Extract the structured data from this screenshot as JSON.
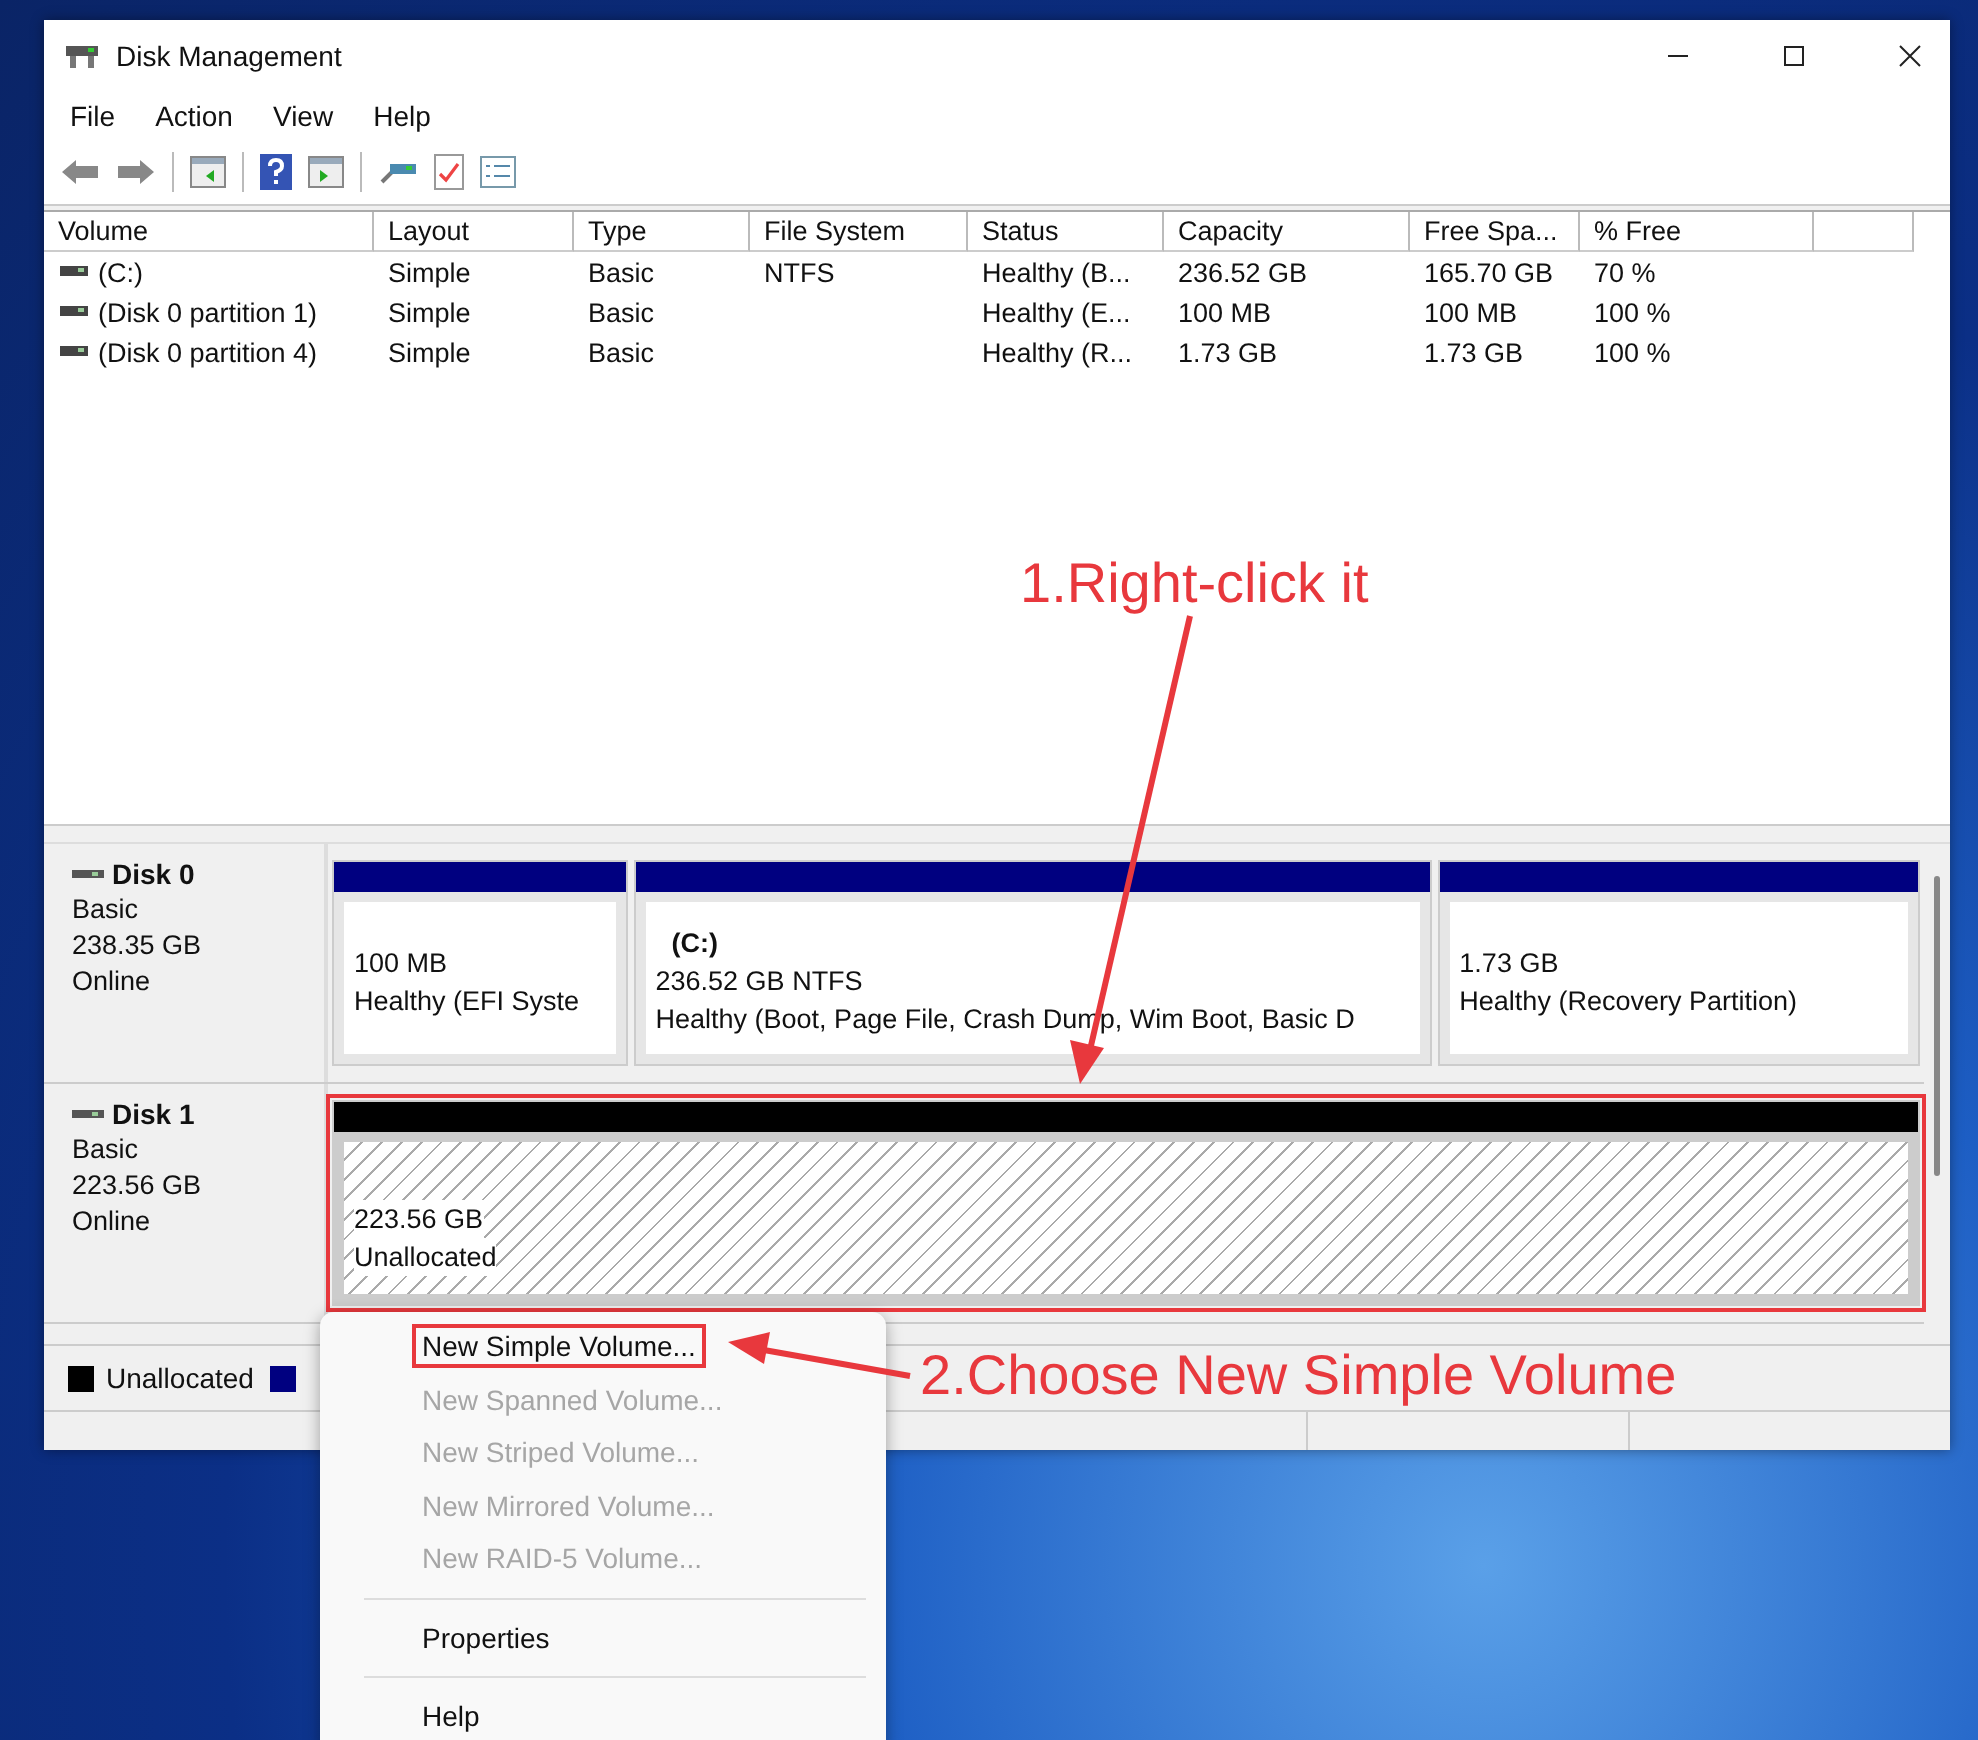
{
  "window": {
    "title": "Disk Management"
  },
  "menu_bar": [
    "File",
    "Action",
    "View",
    "Help"
  ],
  "volume_table": {
    "columns": [
      "Volume",
      "Layout",
      "Type",
      "File System",
      "Status",
      "Capacity",
      "Free Spa...",
      "% Free"
    ],
    "rows": [
      [
        "(C:)",
        "Simple",
        "Basic",
        "NTFS",
        "Healthy (B...",
        "236.52 GB",
        "165.70 GB",
        "70 %"
      ],
      [
        "(Disk 0 partition 1)",
        "Simple",
        "Basic",
        "",
        "Healthy (E...",
        "100 MB",
        "100 MB",
        "100 %"
      ],
      [
        "(Disk 0 partition 4)",
        "Simple",
        "Basic",
        "",
        "Healthy (R...",
        "1.73 GB",
        "1.73 GB",
        "100 %"
      ]
    ]
  },
  "disks": [
    {
      "name": "Disk 0",
      "type": "Basic",
      "size": "238.35 GB",
      "status": "Online",
      "partitions": [
        {
          "kind": "primary",
          "size": "100 MB",
          "status": "Healthy (EFI Syste",
          "highlighted": false
        },
        {
          "kind": "primary",
          "label": "(C:)",
          "size": "236.52 GB NTFS",
          "status": "Healthy (Boot, Page File, Crash Dump, Wim Boot, Basic D",
          "highlighted": false
        },
        {
          "kind": "primary",
          "size": "1.73 GB",
          "status": "Healthy (Recovery Partition)",
          "highlighted": false
        }
      ]
    },
    {
      "name": "Disk 1",
      "type": "Basic",
      "size": "223.56 GB",
      "status": "Online",
      "partitions": [
        {
          "kind": "unallocated",
          "size": "223.56 GB",
          "status": "Unallocated",
          "highlighted": true
        }
      ]
    }
  ],
  "legend": [
    {
      "label": "Unallocated",
      "color": "#000000"
    },
    {
      "color": "#000080"
    }
  ],
  "context_menu": {
    "items": [
      {
        "kind": "item",
        "label": "New Simple Volume...",
        "disabled": false,
        "highlighted": true
      },
      {
        "kind": "item",
        "label": "New Spanned Volume...",
        "disabled": true,
        "highlighted": false
      },
      {
        "kind": "item",
        "label": "New Striped Volume...",
        "disabled": true,
        "highlighted": false
      },
      {
        "kind": "item",
        "label": "New Mirrored Volume...",
        "disabled": true,
        "highlighted": false
      },
      {
        "kind": "item",
        "label": "New RAID-5 Volume...",
        "disabled": true,
        "highlighted": false
      },
      {
        "kind": "separator"
      },
      {
        "kind": "item",
        "label": "Properties",
        "disabled": false,
        "highlighted": false
      },
      {
        "kind": "separator"
      },
      {
        "kind": "item",
        "label": "Help",
        "disabled": false,
        "highlighted": false
      }
    ]
  },
  "annotations": [
    "1.Right-click it",
    "2.Choose New Simple Volume"
  ]
}
